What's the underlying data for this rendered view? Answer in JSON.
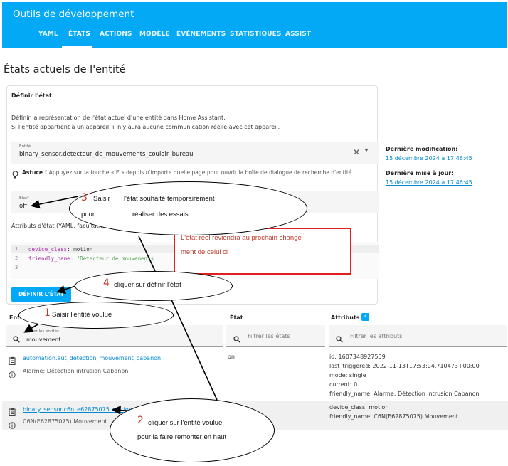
{
  "app": {
    "title": "Outils de développement",
    "tabs": [
      "YAML",
      "ÉTATS",
      "ACTIONS",
      "MODÈLE",
      "ÉVÉNEMENTS",
      "STATISTIQUES",
      "ASSIST"
    ],
    "active_tab": "ÉTATS"
  },
  "page": {
    "heading": "États actuels de l'entité"
  },
  "set_state": {
    "title": "Définir l'état",
    "desc1": "Définir la représentation de l'état actuel d'une entité dans Home Assistant.",
    "desc2": "Si l'entité appartient à un appareil, il n'y aura aucune communication réelle avec cet appareil.",
    "entity_label": "Entité",
    "entity_value": "binary_sensor.detecteur_de_mouvements_couloir_bureau",
    "tip_bold": "Astuce !",
    "tip_text": "Appuyez sur la touche « E » depuis n'importe quelle page pour ouvrir la boîte de dialogue de recherche d'entité",
    "state_label": "État*",
    "state_value": "off",
    "attributes_label": "Attributs d'état (YAML, facultatif)",
    "code_lines": [
      {
        "num": "1",
        "key": "device_class",
        "val": "motion"
      },
      {
        "num": "2",
        "key": "friendly_name",
        "val": "\"Détecteur de mouvements"
      },
      {
        "num": "3",
        "key": "",
        "val": ""
      }
    ],
    "button": "DÉFINIR L'ÉTAT",
    "last_changed_label": "Dernière modification:",
    "last_changed_value": "15 décembre 2024 à 17:46:45",
    "last_updated_label": "Dernière mise à jour:",
    "last_updated_value": "15 décembre 2024 à 17:46:45"
  },
  "table": {
    "col_entity": "Entité",
    "col_state": "État",
    "col_attributes": "Attributs",
    "attributes_checked": true,
    "filter_entities_label": "Filtrer les entités",
    "filter_entities_value": "mouvement",
    "filter_states_placeholder": "Filtrer les états",
    "filter_attributes_placeholder": "Filtrer les attributs",
    "rows": [
      {
        "entity_id": "automation.aut_detection_mouvement_cabanon",
        "name": "Alarme: Détection intrusion Cabanon",
        "state": "on",
        "attributes": [
          "id: 1607348927559",
          "last_triggered: 2022-11-13T17:53:04.710473+00:00",
          "mode: single",
          "current: 0",
          "friendly_name: Alarme: Détection intrusion Cabanon"
        ]
      },
      {
        "entity_id": "binary_sensor.c6n_e62875075_motion",
        "name": "C6N(E62875075) Mouvement",
        "state": "",
        "attributes": [
          "device_class: motion",
          "friendly_name: C6N(E62875075) Mouvement"
        ]
      }
    ]
  },
  "annotations": {
    "c3_num": "3",
    "c3_l1a": "Saisir",
    "c3_l1b": "l'état souhaité temporairement",
    "c3_l2a": "pour",
    "c3_l2b": "réaliser des essais",
    "c4_num": "4",
    "c4_text": "cliquer sur définir l'état",
    "c1_num": "1",
    "c1_text": "Saisir l'entité voulue",
    "c2_num": "2",
    "c2_l1": "cliquer sur l'entité voulue,",
    "c2_l2": "pour la faire remonter en haut",
    "red_l1": "L'état réel reviendra au prochain change-",
    "red_l2": "ment de celui ci"
  },
  "colors": {
    "primary": "#03a9f4",
    "link": "#0288d1",
    "annotation_red": "#c0392b",
    "red_box": "#e02020"
  }
}
